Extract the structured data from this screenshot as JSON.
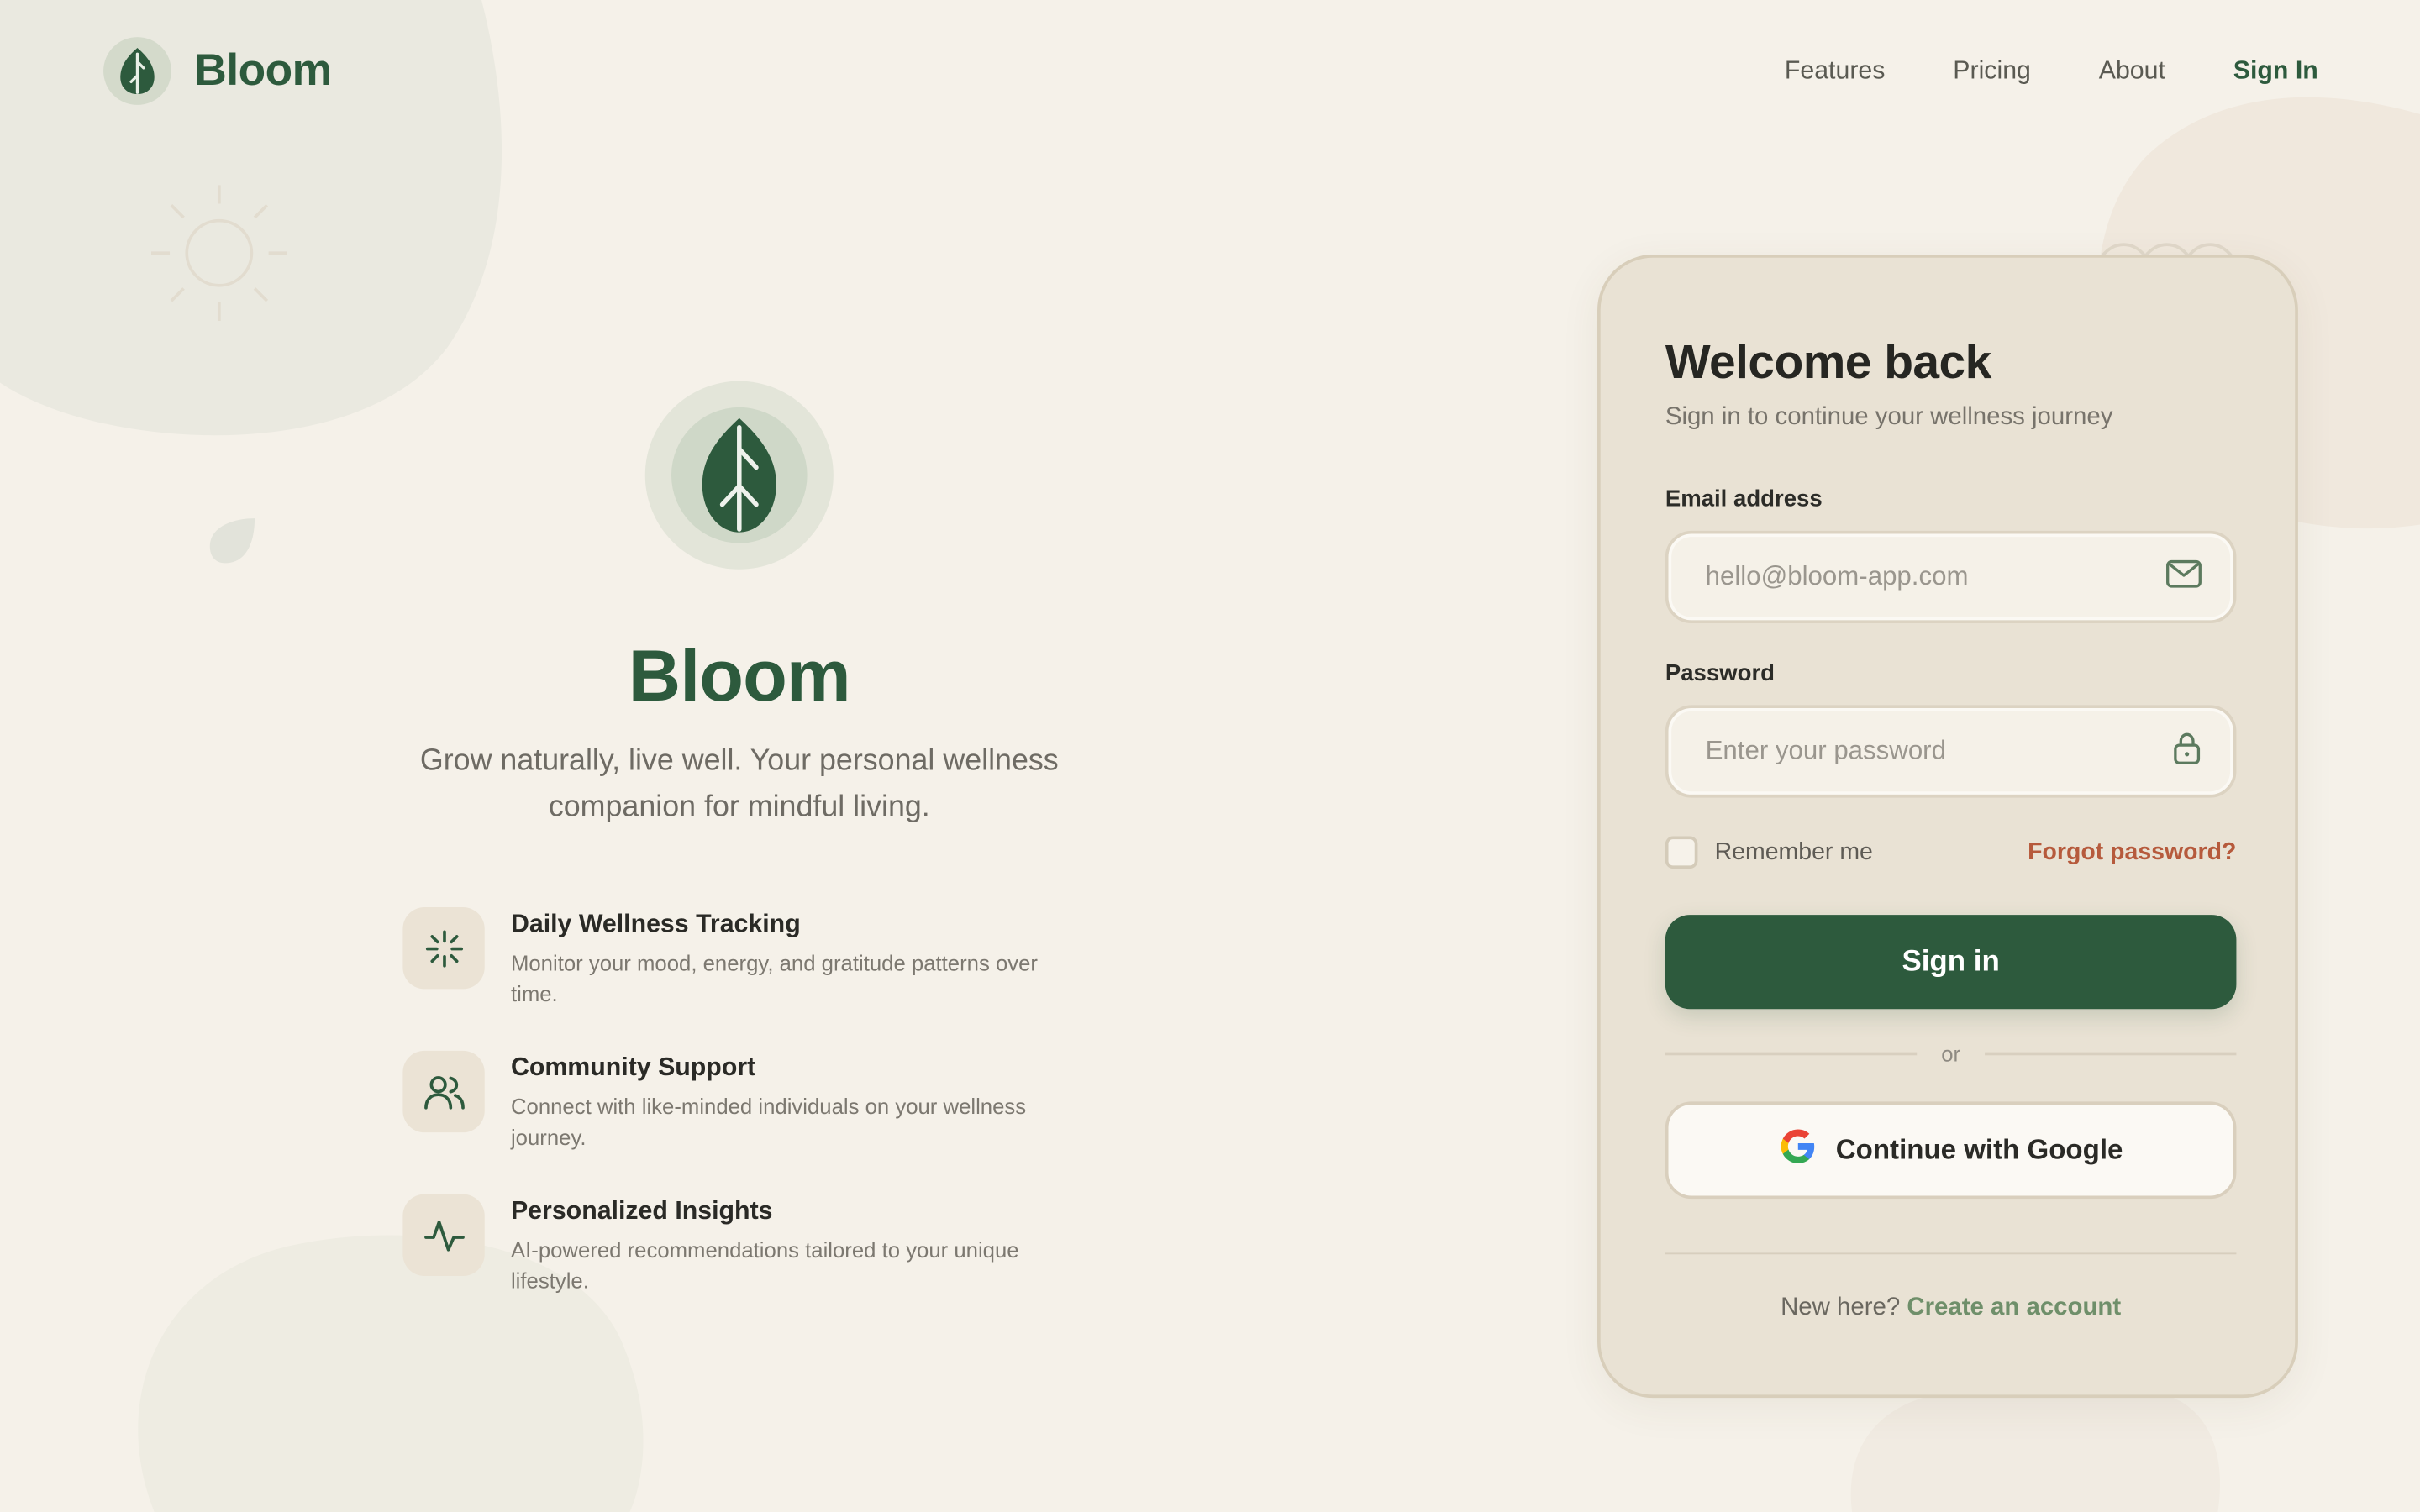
{
  "brand": {
    "name": "Bloom",
    "logo_icon": "leaf-icon"
  },
  "nav": {
    "features": "Features",
    "pricing": "Pricing",
    "about": "About",
    "sign_in": "Sign In"
  },
  "hero": {
    "title": "Bloom",
    "subtitle": "Grow naturally, live well. Your personal wellness companion for mindful living."
  },
  "features": [
    {
      "icon": "sparkle-icon",
      "title": "Daily Wellness Tracking",
      "desc": "Monitor your mood, energy, and gratitude patterns over time."
    },
    {
      "icon": "users-icon",
      "title": "Community Support",
      "desc": "Connect with like-minded individuals on your wellness journey."
    },
    {
      "icon": "activity-icon",
      "title": "Personalized Insights",
      "desc": "AI-powered recommendations tailored to your unique lifestyle."
    }
  ],
  "login": {
    "title": "Welcome back",
    "subtitle": "Sign in to continue your wellness journey",
    "email_label": "Email address",
    "email_placeholder": "hello@bloom-app.com",
    "password_label": "Password",
    "password_placeholder": "Enter your password",
    "remember_label": "Remember me",
    "forgot_label": "Forgot password?",
    "submit_label": "Sign in",
    "divider_text": "or",
    "google_label": "Continue with Google",
    "new_here": "New here?",
    "create_account": "Create an account"
  },
  "colors": {
    "primary": "#2d5a3d",
    "accent": "#b65a3c",
    "background": "#f5f1e9",
    "card": "#e9e2d4"
  }
}
